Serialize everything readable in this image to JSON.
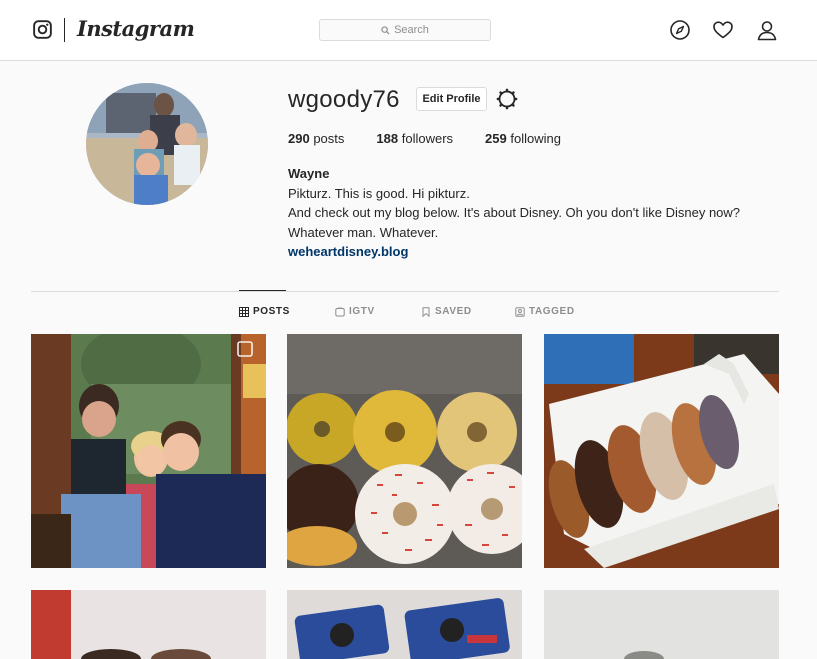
{
  "header": {
    "wordmark": "Instagram",
    "search_placeholder": "Search",
    "icons": [
      "explore-icon",
      "heart-icon",
      "profile-icon"
    ]
  },
  "profile": {
    "username": "wgoody76",
    "edit_label": "Edit Profile",
    "stats": {
      "posts_count": "290",
      "posts_label": "posts",
      "followers_count": "188",
      "followers_label": "followers",
      "following_count": "259",
      "following_label": "following"
    },
    "bio": {
      "name": "Wayne",
      "line1": "Pikturz. This is good. Hi pikturz.",
      "line2": "And check out my blog below. It's about Disney. Oh you don't like Disney now?",
      "line3": "Whatever man. Whatever.",
      "link": "weheartdisney.blog"
    }
  },
  "tabs": [
    {
      "label": "POSTS",
      "active": true
    },
    {
      "label": "IGTV",
      "active": false
    },
    {
      "label": "SAVED",
      "active": false
    },
    {
      "label": "TAGGED",
      "active": false
    }
  ],
  "colors": {
    "link": "#003569",
    "border": "#dbdbdb",
    "muted": "#8e8e8e",
    "text": "#262626"
  }
}
